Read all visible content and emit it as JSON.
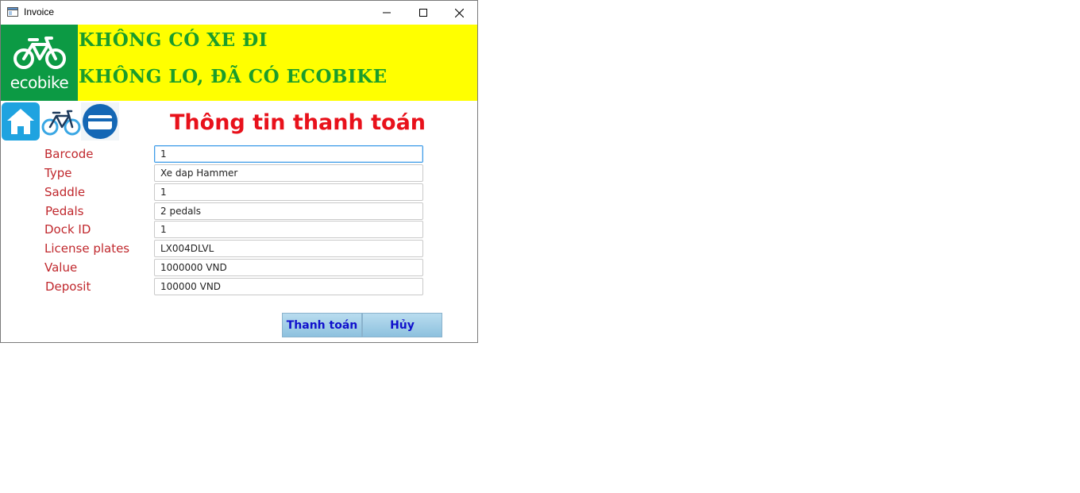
{
  "window": {
    "title": "Invoice"
  },
  "banner": {
    "logo_text": "ecobike",
    "slogan_line1": "KHÔNG CÓ XE ĐI",
    "slogan_line2": "KHÔNG LO, ĐÃ CÓ ECOBIKE",
    "background": "#ffff00",
    "logo_background": "#0c9a44"
  },
  "nav": {
    "icons": [
      "home-icon",
      "bike-icon",
      "card-icon"
    ]
  },
  "page": {
    "heading": "Thông tin thanh toán"
  },
  "fields": [
    {
      "label": "Barcode",
      "value": "1"
    },
    {
      "label": "Type",
      "value": "Xe dap Hammer"
    },
    {
      "label": "Saddle",
      "value": "1"
    },
    {
      "label": "Pedals",
      "value": "2 pedals"
    },
    {
      "label": "Dock ID",
      "value": "1"
    },
    {
      "label": "License plates",
      "value": "LX004DLVL"
    },
    {
      "label": "Value",
      "value": "1000000 VND"
    },
    {
      "label": "Deposit",
      "value": "100000 VND"
    }
  ],
  "actions": {
    "pay_label": "Thanh toán",
    "cancel_label": "Hủy"
  },
  "colors": {
    "heading": "#e8111b",
    "label": "#c0282d",
    "slogan": "#1b9d2b",
    "button_text": "#1010cc"
  }
}
